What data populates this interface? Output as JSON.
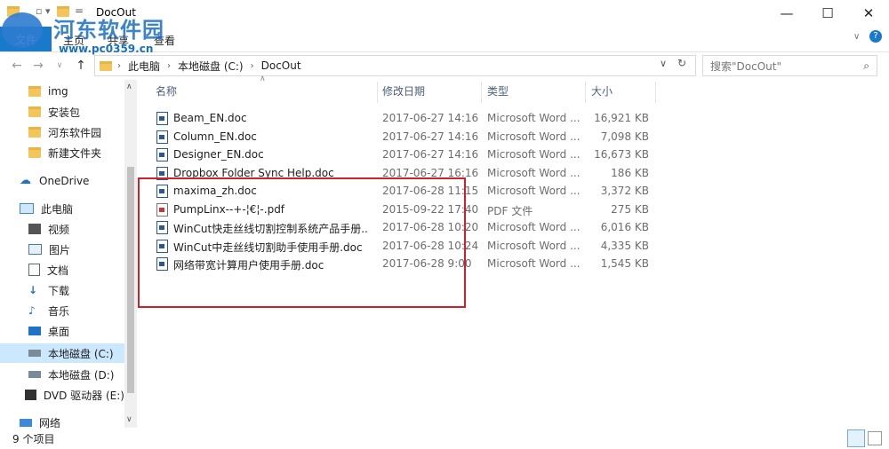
{
  "window": {
    "title": "DocOut",
    "minimize": "—",
    "maximize": "☐",
    "close": "✕",
    "help": "?"
  },
  "ribbon": {
    "file": "文件",
    "tabs": [
      "主页",
      "共享",
      "查看"
    ]
  },
  "address": {
    "parts": [
      "此电脑",
      "本地磁盘 (C:)",
      "DocOut"
    ]
  },
  "search": {
    "placeholder": "搜索\"DocOut\""
  },
  "nav": {
    "quick": [
      "img",
      "安装包",
      "河东软件园",
      "新建文件夹"
    ],
    "onedrive": "OneDrive",
    "pc": "此电脑",
    "pc_items": [
      "视频",
      "图片",
      "文档",
      "下载",
      "音乐",
      "桌面",
      "本地磁盘 (C:)",
      "本地磁盘 (D:)",
      "DVD 驱动器 (E:)"
    ],
    "network": "网络"
  },
  "columns": {
    "name": "名称",
    "date": "修改日期",
    "type": "类型",
    "size": "大小"
  },
  "files": [
    {
      "name": "Beam_EN.doc",
      "date": "2017-06-27 14:16",
      "type": "Microsoft Word ...",
      "size": "16,921 KB"
    },
    {
      "name": "Column_EN.doc",
      "date": "2017-06-27 14:16",
      "type": "Microsoft Word ...",
      "size": "7,098 KB"
    },
    {
      "name": "Designer_EN.doc",
      "date": "2017-06-27 14:16",
      "type": "Microsoft Word ...",
      "size": "16,673 KB"
    },
    {
      "name": "Dropbox Folder Sync Help.doc",
      "date": "2017-06-27 16:16",
      "type": "Microsoft Word ...",
      "size": "186 KB"
    },
    {
      "name": "maxima_zh.doc",
      "date": "2017-06-28 11:15",
      "type": "Microsoft Word ...",
      "size": "3,372 KB"
    },
    {
      "name": "PumpLinx--+-¦€¦-.pdf",
      "date": "2015-09-22 17:40",
      "type": "PDF 文件",
      "size": "275 KB"
    },
    {
      "name": "WinCut快走丝线切割控制系统产品手册....",
      "date": "2017-06-28 10:20",
      "type": "Microsoft Word ...",
      "size": "6,016 KB"
    },
    {
      "name": "WinCut中走丝线切割助手使用手册.doc",
      "date": "2017-06-28 10:24",
      "type": "Microsoft Word ...",
      "size": "4,335 KB"
    },
    {
      "name": "网络带宽计算用户使用手册.doc",
      "date": "2017-06-28 9:00",
      "type": "Microsoft Word ...",
      "size": "1,545 KB"
    }
  ],
  "status": {
    "count": "9 个项目"
  },
  "watermark": {
    "title": "河东软件园",
    "url": "www.pc0359.cn"
  }
}
